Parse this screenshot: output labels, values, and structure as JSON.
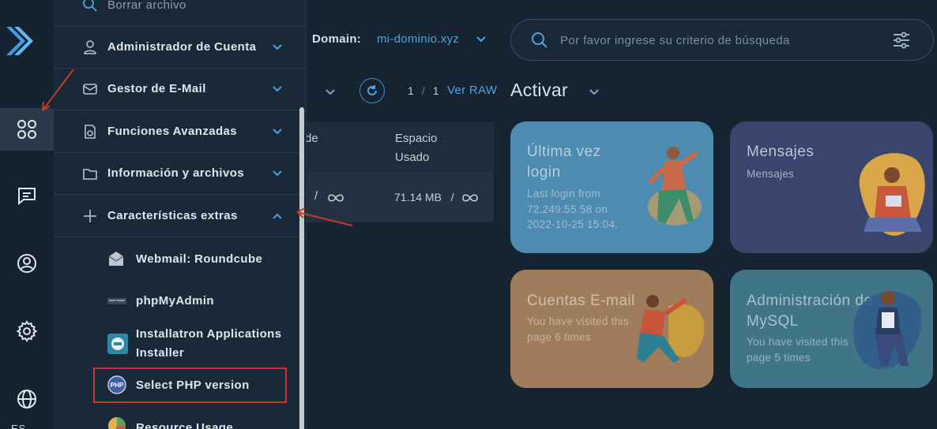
{
  "header": {
    "domain_label": "Domain:",
    "domain_value": "mi-dominio.xyz",
    "search_placeholder": "Por favor ingrese su criterio de búsqueda"
  },
  "toolbar": {
    "page_current": "1",
    "page_sep": "/",
    "page_total": "1",
    "raw_link": "Ver RAW",
    "activar": "Activar"
  },
  "table": {
    "col1_fragment": "de",
    "col2": "Espacio Usado",
    "row_col1_sep": "/",
    "row_col2_value": "71.14 MB",
    "row_col2_sep": "/"
  },
  "cards": [
    {
      "title": "Última vez login",
      "subtitle": "Last login from 72.249.55.58 on 2022-10-25 15:04."
    },
    {
      "title": "Mensajes",
      "subtitle": "Mensajes"
    },
    {
      "title": "Cuentas E-mail",
      "subtitle": "You have visited this page 6 times"
    },
    {
      "title": "Administración de MySQL",
      "subtitle": "You have visited this page 5 times"
    }
  ],
  "menu": {
    "top_partial": "Borrar archivo",
    "items": [
      {
        "label": "Administrador de Cuenta",
        "icon": "user-icon"
      },
      {
        "label": "Gestor de E-Mail",
        "icon": "mail-icon"
      },
      {
        "label": "Funciones Avanzadas",
        "icon": "advanced-settings-icon"
      },
      {
        "label": "Información y archivos",
        "icon": "folder-icon"
      },
      {
        "label": "Características extras",
        "icon": "plus-icon"
      }
    ],
    "sub_items": [
      {
        "label": "Webmail: Roundcube",
        "icon": "roundcube-icon"
      },
      {
        "label": "phpMyAdmin",
        "icon": "phpmyadmin-icon"
      },
      {
        "label": "Installatron Applications Installer",
        "icon": "installatron-icon"
      },
      {
        "label": "Select PHP version",
        "icon": "php-icon"
      },
      {
        "label": "Resource Usage",
        "icon": "resource-usage-icon"
      }
    ]
  },
  "rail": {
    "language": "ES"
  },
  "colors": {
    "accent_blue": "#4ea3e0",
    "annotation_red": "#c6382c",
    "card_login": "#4d8bb0",
    "card_messages": "#39456c",
    "card_email": "#9f7c5c",
    "card_mysql": "#3f7587"
  }
}
